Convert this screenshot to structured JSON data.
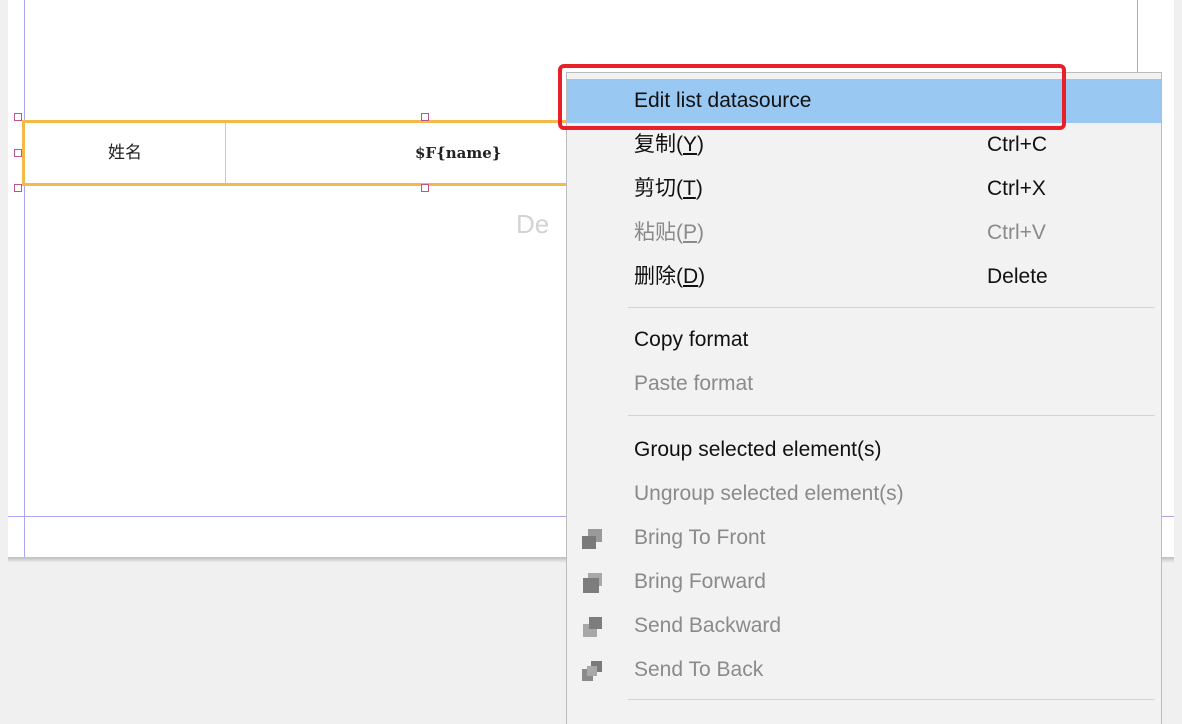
{
  "band": {
    "label_cell": "姓名",
    "field_cell": "$F{name}",
    "background_ghost_text": "De"
  },
  "context_menu": {
    "items": [
      {
        "label": "Edit list datasource",
        "shortcut": "",
        "enabled": true,
        "highlighted": true
      },
      {
        "label": "复制",
        "mnemonic": "Y",
        "shortcut": "Ctrl+C",
        "enabled": true
      },
      {
        "label": "剪切",
        "mnemonic": "T",
        "shortcut": "Ctrl+X",
        "enabled": true
      },
      {
        "label": "粘贴",
        "mnemonic": "P",
        "shortcut": "Ctrl+V",
        "enabled": false
      },
      {
        "label": "删除",
        "mnemonic": "D",
        "shortcut": "Delete",
        "enabled": true
      },
      {
        "label": "Copy format",
        "enabled": true
      },
      {
        "label": "Paste format",
        "enabled": false
      },
      {
        "label": "Group selected element(s)",
        "enabled": true
      },
      {
        "label": "Ungroup selected element(s)",
        "enabled": false
      },
      {
        "label": "Bring To Front",
        "icon": "bring-to-front-icon",
        "enabled": false
      },
      {
        "label": "Bring Forward",
        "icon": "bring-forward-icon",
        "enabled": false
      },
      {
        "label": "Send Backward",
        "icon": "send-backward-icon",
        "enabled": false
      },
      {
        "label": "Send To Back",
        "icon": "send-to-back-icon",
        "enabled": false
      }
    ]
  },
  "colors": {
    "highlight": "#99c9f3",
    "callout": "#e8202a",
    "band_border": "#f5b84a",
    "guide": "#a9a4f4"
  }
}
